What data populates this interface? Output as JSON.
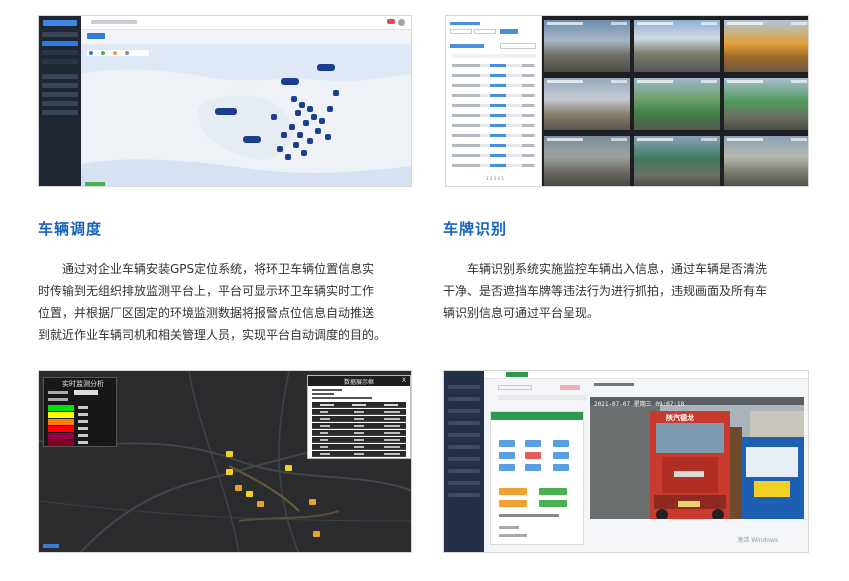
{
  "sections": {
    "dispatch": {
      "title": "车辆调度",
      "lines": [
        "通过对企业车辆安装GPS定位系统，将环卫车辆位置信息实",
        "时传输到无组织排放监测平台上，平台可显示环卫车辆实时工作",
        "位置，并根据厂区固定的环境监测数据将报警点位信息自动推送",
        "到就近作业车辆司机和相关管理人员，实现平台自动调度的目的。"
      ]
    },
    "plate": {
      "title": "车牌识别",
      "lines": [
        "车辆识别系统实施监控车辆出入信息，通过车辆是否清洗",
        "干净、是否遮挡车牌等违法行为进行抓拍，违规画面及所有车",
        "辆识别信息可通过平台呈现。"
      ]
    }
  },
  "screenshots": {
    "dispatch_map": {
      "description_icon": "map-icon"
    },
    "plate_recognition": {
      "pagination": "1 2 3 4 5"
    },
    "env_map": {
      "left_panel_title": "实时监测分析",
      "right_panel_title": "数据展示框",
      "close_glyph": "X",
      "legend_colors": [
        "#00e400",
        "#ffff00",
        "#ff7e00",
        "#ff0000",
        "#99004c",
        "#7e0023"
      ]
    },
    "violation": {
      "photo_timestamp": "2021-07-07 星期三 09:07:18",
      "truck_brand": "陕汽德龙",
      "watermark": "激活 Windows"
    }
  },
  "colors": {
    "title_blue": "#1565c0",
    "body_text": "#333333",
    "map_blue": "#1b3f8f"
  }
}
